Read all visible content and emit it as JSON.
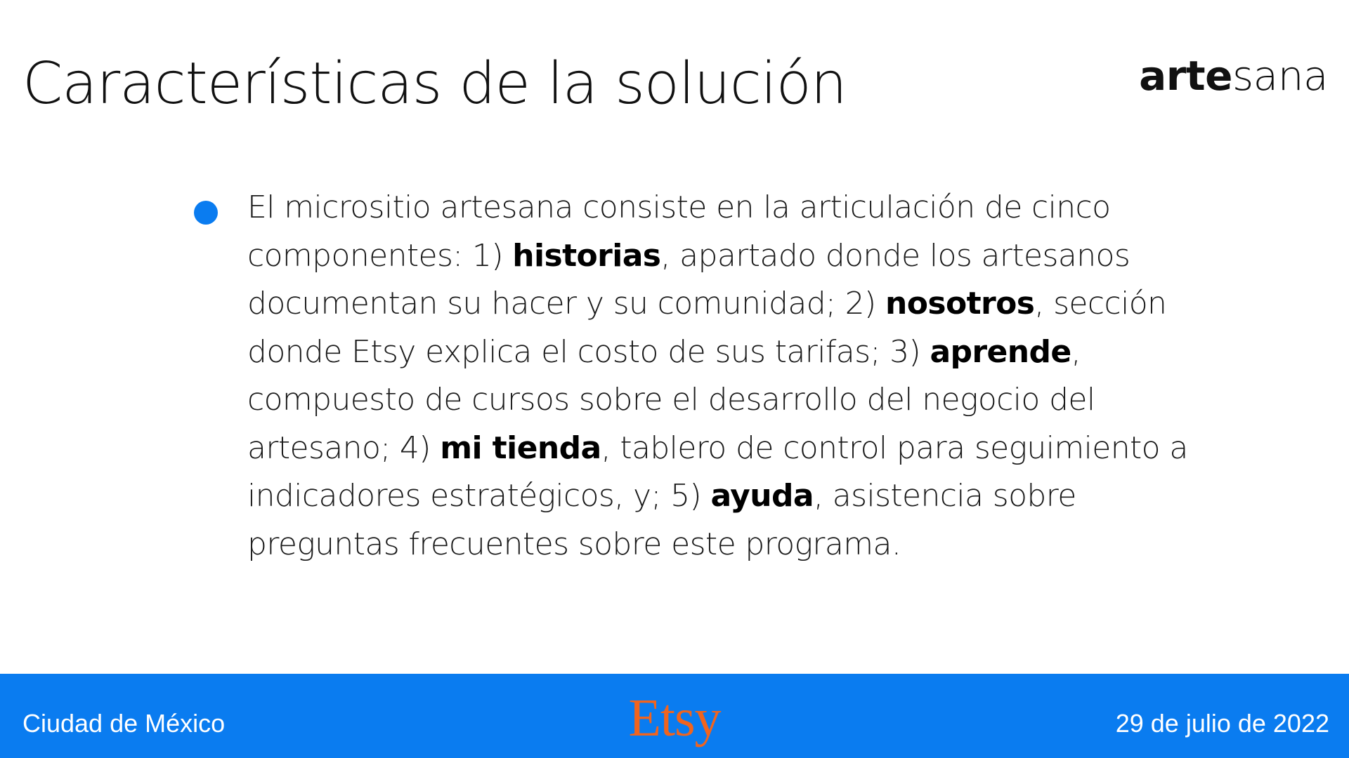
{
  "slide": {
    "title": "Características de la solución",
    "brand": {
      "bold_part": "arte",
      "light_part": "sana"
    },
    "bullet": {
      "parts": [
        {
          "text": "El micrositio artesana consiste en la articulación de cinco componentes: 1) ",
          "bold": false
        },
        {
          "text": "historias",
          "bold": true
        },
        {
          "text": ", apartado donde los artesanos documentan su hacer y su comunidad; 2) ",
          "bold": false
        },
        {
          "text": "nosotros",
          "bold": true
        },
        {
          "text": ", sección donde Etsy explica el costo de sus tarifas; 3) ",
          "bold": false
        },
        {
          "text": "aprende",
          "bold": true
        },
        {
          "text": ", compuesto de cursos sobre el desarrollo del negocio del artesano; 4) ",
          "bold": false
        },
        {
          "text": "mi tienda",
          "bold": true
        },
        {
          "text": ", tablero de control para seguimiento a indicadores estratégicos, y; 5) ",
          "bold": false
        },
        {
          "text": "ayuda",
          "bold": true
        },
        {
          "text": ", asistencia sobre preguntas frecuentes sobre este programa.",
          "bold": false
        }
      ]
    }
  },
  "footer": {
    "location": "Ciudad de México",
    "logo": "Etsy",
    "date": "29 de julio de 2022"
  },
  "colors": {
    "accent_blue": "#0a7cf0",
    "etsy_orange": "#f1641e"
  }
}
